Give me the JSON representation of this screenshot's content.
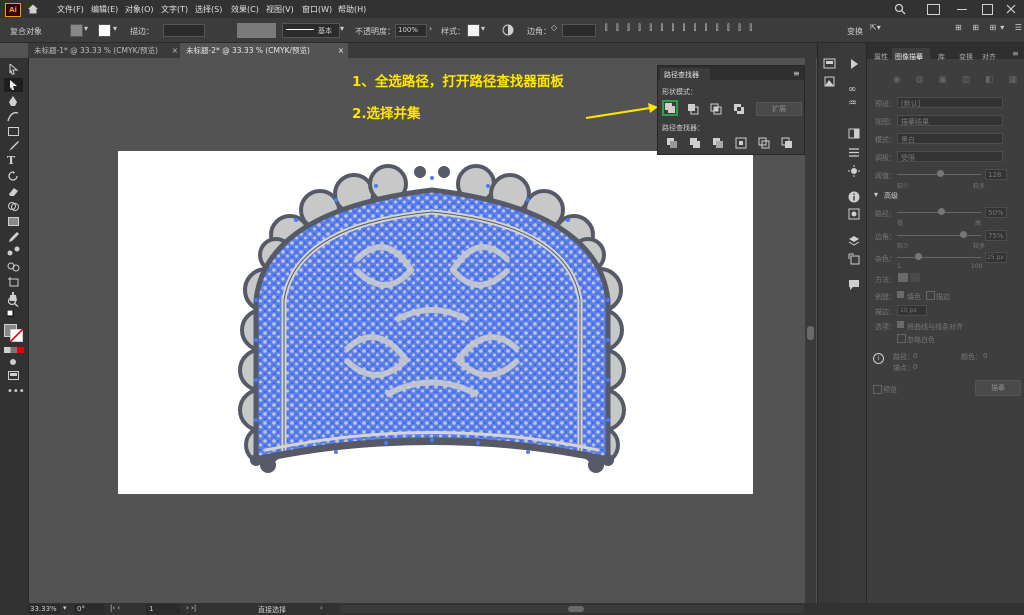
{
  "app": {
    "logo": "Ai"
  },
  "menu": [
    "文件(F)",
    "编辑(E)",
    "对象(O)",
    "文字(T)",
    "选择(S)",
    "效果(C)",
    "视图(V)",
    "窗口(W)",
    "帮助(H)"
  ],
  "control": {
    "object_type": "复合对象",
    "stroke_label": "描边：",
    "brush_label": "基本",
    "opacity_label": "不透明度：",
    "opacity_value": "100%",
    "style_label": "样式：",
    "corner_label": "边角：",
    "transform_label": "变换"
  },
  "tabs": [
    {
      "label": "未标题-1* @ 33.33 % (CMYK/预览)",
      "active": false
    },
    {
      "label": "未标题-2* @ 33.33 % (CMYK/预览)",
      "active": true
    }
  ],
  "pathfinder": {
    "title": "路径查找器",
    "shape_modes_label": "形状模式：",
    "expand_label": "扩展",
    "pathfinders_label": "路径查找器："
  },
  "annotations": {
    "line1": "1、全选路径，打开路径查找器面板",
    "line2": "2.选择并集"
  },
  "props_panel": {
    "tabs": [
      "属性",
      "图像描摹",
      "库",
      "变换",
      "对齐"
    ],
    "preset_label": "预设：",
    "preset_value": "[默认]",
    "view_label": "视图：",
    "view_value": "描摹结果",
    "mode_label": "模式：",
    "mode_value": "黑白",
    "palette_label": "调板：",
    "palette_value": "受限",
    "threshold_label": "阈值：",
    "threshold_value": "128",
    "less": "较少",
    "more": "较多",
    "advanced_label": "高级",
    "paths_label": "路径：",
    "paths_value": "50%",
    "low": "低",
    "high": "高",
    "corners_label": "边角：",
    "corners_value": "75%",
    "noise_label": "杂色：",
    "noise_value": "25 px",
    "noise_min": "1",
    "noise_max": "100",
    "method_label": "方法：",
    "create_label": "创建：",
    "fill_label": "填色",
    "stroke_label": "描边",
    "stroke2_label": "描边：",
    "stroke_value": "10 px",
    "options_label": "选项：",
    "snap_label": "将曲线与线条对齐",
    "ignore_white": "忽略白色",
    "path_count_label": "路径：",
    "path_count": "0",
    "color_count_label": "颜色：",
    "color_count": "0",
    "anchor_count_label": "锚点：",
    "anchor_count": "0",
    "preview_label": "预览",
    "trace_button": "描摹"
  },
  "status": {
    "zoom": "33.33%",
    "angle": "0°",
    "artboard": "1",
    "tool": "直接选择"
  },
  "colors": {
    "annotation": "#ffe600",
    "selection": "#4a7bff",
    "shape_fill": "#c8c8c8",
    "shape_stroke": "#565a66"
  }
}
